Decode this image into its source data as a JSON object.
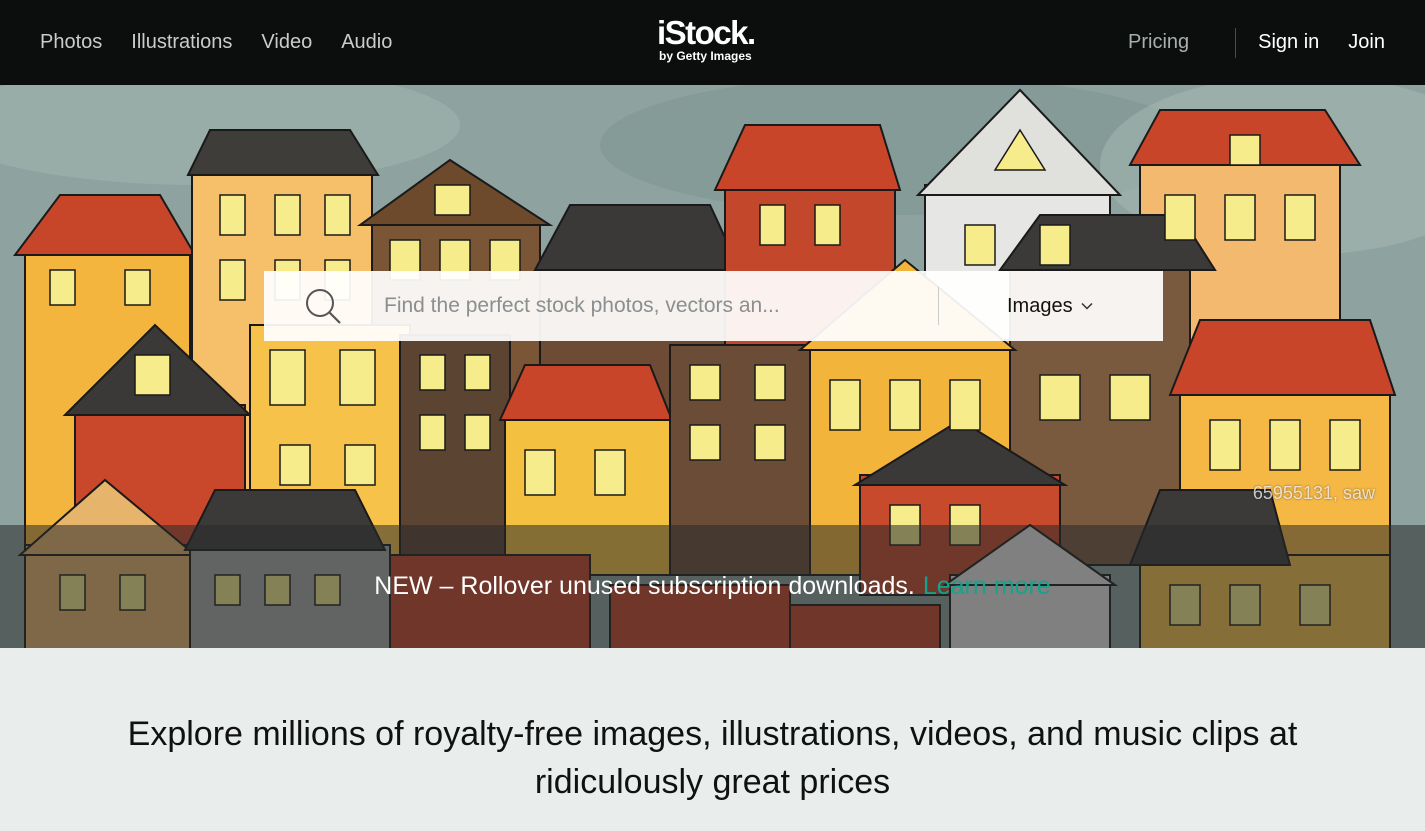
{
  "nav": {
    "left_links": [
      "Photos",
      "Illustrations",
      "Video",
      "Audio"
    ],
    "logo": {
      "brand": "iStock.",
      "tagline": "by Getty Images"
    },
    "pricing": "Pricing",
    "sign_in": "Sign in",
    "join": "Join"
  },
  "hero": {
    "image_credit": "65955131, saw",
    "search": {
      "placeholder": "Find the perfect stock photos, vectors an...",
      "type_selected": "Images"
    },
    "banner": {
      "text": "NEW – Rollover unused subscription downloads.",
      "link": "Learn more",
      "link_color": "#14a38c"
    }
  },
  "explore": {
    "headline": "Explore millions of royalty-free images, illustrations, videos, and music clips at ridiculously great prices"
  },
  "icons": {
    "search": "search-icon",
    "type_dropdown": "chevron-down-icon"
  }
}
